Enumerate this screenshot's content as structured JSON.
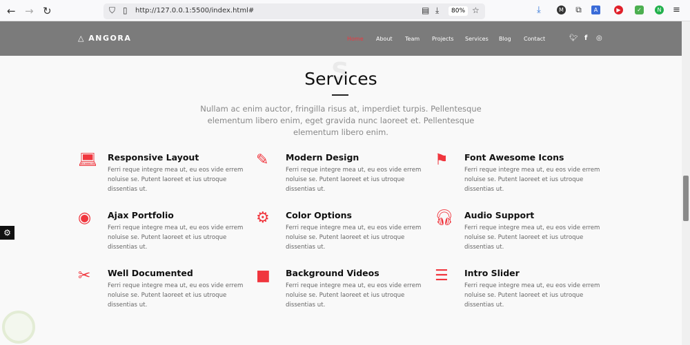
{
  "browser": {
    "url": "http://127.0.0.1:5500/index.html#",
    "zoom": "80%"
  },
  "nav": {
    "logo": "ANGORA",
    "items": [
      "Home",
      "About",
      "Team",
      "Projects",
      "Services",
      "Blog",
      "Contact"
    ],
    "active_color": "#f0363e"
  },
  "section": {
    "watermark": "S",
    "title": "Services",
    "lead": "Nullam ac enim auctor, fringilla risus at, imperdiet turpis. Pellentesque elementum libero enim, eget gravida nunc laoreet et. Pellentesque elementum libero enim."
  },
  "services": [
    {
      "icon": "laptop-icon",
      "title": "Responsive Layout",
      "text": "Ferri reque integre mea ut, eu eos vide errem noluise se. Putent laoreet et ius utroque dissentias ut."
    },
    {
      "icon": "pencil-ruler-icon",
      "title": "Modern Design",
      "text": "Ferri reque integre mea ut, eu eos vide errem noluise se. Putent laoreet et ius utroque dissentias ut."
    },
    {
      "icon": "flag-icon",
      "title": "Font Awesome Icons",
      "text": "Ferri reque integre mea ut, eu eos vide errem noluise se. Putent laoreet et ius utroque dissentias ut."
    },
    {
      "icon": "podcast-icon",
      "title": "Ajax Portfolio",
      "text": "Ferri reque integre mea ut, eu eos vide errem noluise se. Putent laoreet et ius utroque dissentias ut."
    },
    {
      "icon": "cog-icon",
      "title": "Color Options",
      "text": "Ferri reque integre mea ut, eu eos vide errem noluise se. Putent laoreet et ius utroque dissentias ut."
    },
    {
      "icon": "headphones-icon",
      "title": "Audio Support",
      "text": "Ferri reque integre mea ut, eu eos vide errem noluise se. Putent laoreet et ius utroque dissentias ut."
    },
    {
      "icon": "tools-icon",
      "title": "Well Documented",
      "text": "Ferri reque integre mea ut, eu eos vide errem noluise se. Putent laoreet et ius utroque dissentias ut."
    },
    {
      "icon": "video-icon",
      "title": "Background Videos",
      "text": "Ferri reque integre mea ut, eu eos vide errem noluise se. Putent laoreet et ius utroque dissentias ut."
    },
    {
      "icon": "sliders-icon",
      "title": "Intro Slider",
      "text": "Ferri reque integre mea ut, eu eos vide errem noluise se. Putent laoreet et ius utroque dissentias ut."
    }
  ]
}
